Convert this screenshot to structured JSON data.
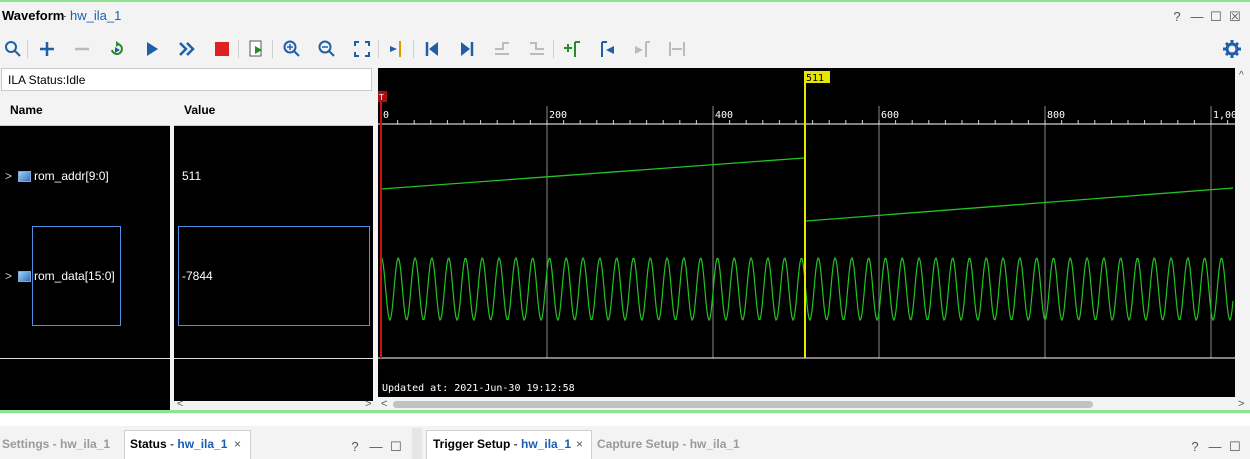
{
  "window": {
    "title": "Waveform",
    "title_sep": "-",
    "subtitle": "hw_ila_1",
    "controls": [
      "?",
      "—",
      "☐",
      "☒"
    ]
  },
  "toolbar": {
    "icons": [
      "search-icon",
      "plus-icon",
      "minus-icon",
      "refresh-icon",
      "play-icon",
      "fast-forward-icon",
      "stop-icon",
      "export-icon",
      "zoom-in-icon",
      "zoom-out-icon",
      "zoom-fit-icon",
      "go-to-cursor-icon",
      "go-to-start-icon",
      "go-to-end-icon",
      "previous-transition-icon",
      "next-transition-icon",
      "add-marker-icon",
      "previous-marker-icon",
      "next-marker-icon",
      "swap-cursors-icon",
      "gear-icon"
    ]
  },
  "ila_status": "ILA Status:Idle",
  "columns": {
    "name": "Name",
    "value": "Value"
  },
  "signals": [
    {
      "name": "rom_addr[9:0]",
      "value": "511",
      "chevron": ">"
    },
    {
      "name": "rom_data[15:0]",
      "value": "-7844",
      "chevron": ">"
    }
  ],
  "waveform": {
    "marker_label": "511",
    "start_marker": "T",
    "x_ticks": [
      "0",
      "200",
      "400",
      "600",
      "800",
      "1,00"
    ],
    "updated": "Updated at: 2021-Jun-30 19:12:58",
    "colors": {
      "wave": "#22c322",
      "cursor": "#e6e600",
      "trigger": "#cc1111",
      "grid": "#ffffff"
    }
  },
  "bottom_left": {
    "tabs": [
      {
        "label": "Settings",
        "sep": " - ",
        "sub": "hw_ila_1",
        "active": false
      },
      {
        "label": "Status",
        "sep": " - ",
        "sub": "hw_ila_1",
        "active": true
      }
    ],
    "close": "×",
    "controls": [
      "?",
      "—",
      "☐"
    ]
  },
  "bottom_right": {
    "tabs": [
      {
        "label": "Trigger Setup",
        "sep": " - ",
        "sub": "hw_ila_1",
        "active": true
      },
      {
        "label": "Capture Setup",
        "sep": " - ",
        "sub": "hw_ila_1",
        "active": false
      }
    ],
    "close": "×",
    "controls": [
      "?",
      "—",
      "☐"
    ]
  }
}
